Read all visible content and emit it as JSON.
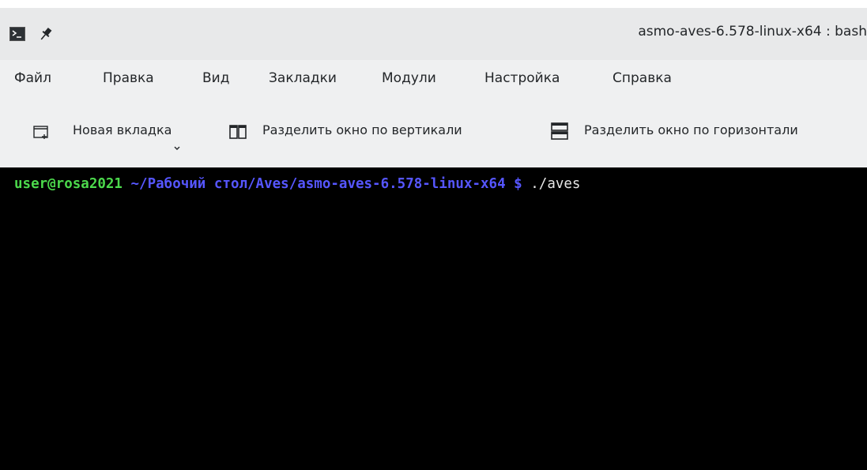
{
  "window": {
    "title": "asmo-aves-6.578-linux-x64 : bash",
    "app_icon": "terminal-icon",
    "pin_icon": "pin-icon"
  },
  "menubar": {
    "items": [
      {
        "label": "Файл"
      },
      {
        "label": "Правка"
      },
      {
        "label": "Вид"
      },
      {
        "label": "Закладки"
      },
      {
        "label": "Модули"
      },
      {
        "label": "Настройка"
      },
      {
        "label": "Справка"
      }
    ]
  },
  "toolbar": {
    "new_tab": {
      "label": "Новая вкладка",
      "icon": "new-tab-icon",
      "has_dropdown": true
    },
    "split_vertical": {
      "label": "Разделить окно по вертикали",
      "icon": "split-vertical-icon"
    },
    "split_horizontal": {
      "label": "Разделить окно по горизонтали",
      "icon": "split-horizontal-icon"
    }
  },
  "terminal": {
    "user_host": "user@rosa2021",
    "path": "~/Рабочий стол/Aves/asmo-aves-6.578-linux-x64 $",
    "command": "./aves",
    "colors": {
      "background": "#000000",
      "user_host": "#4cd94c",
      "path": "#5656ff",
      "command": "#e6e6e6"
    }
  }
}
